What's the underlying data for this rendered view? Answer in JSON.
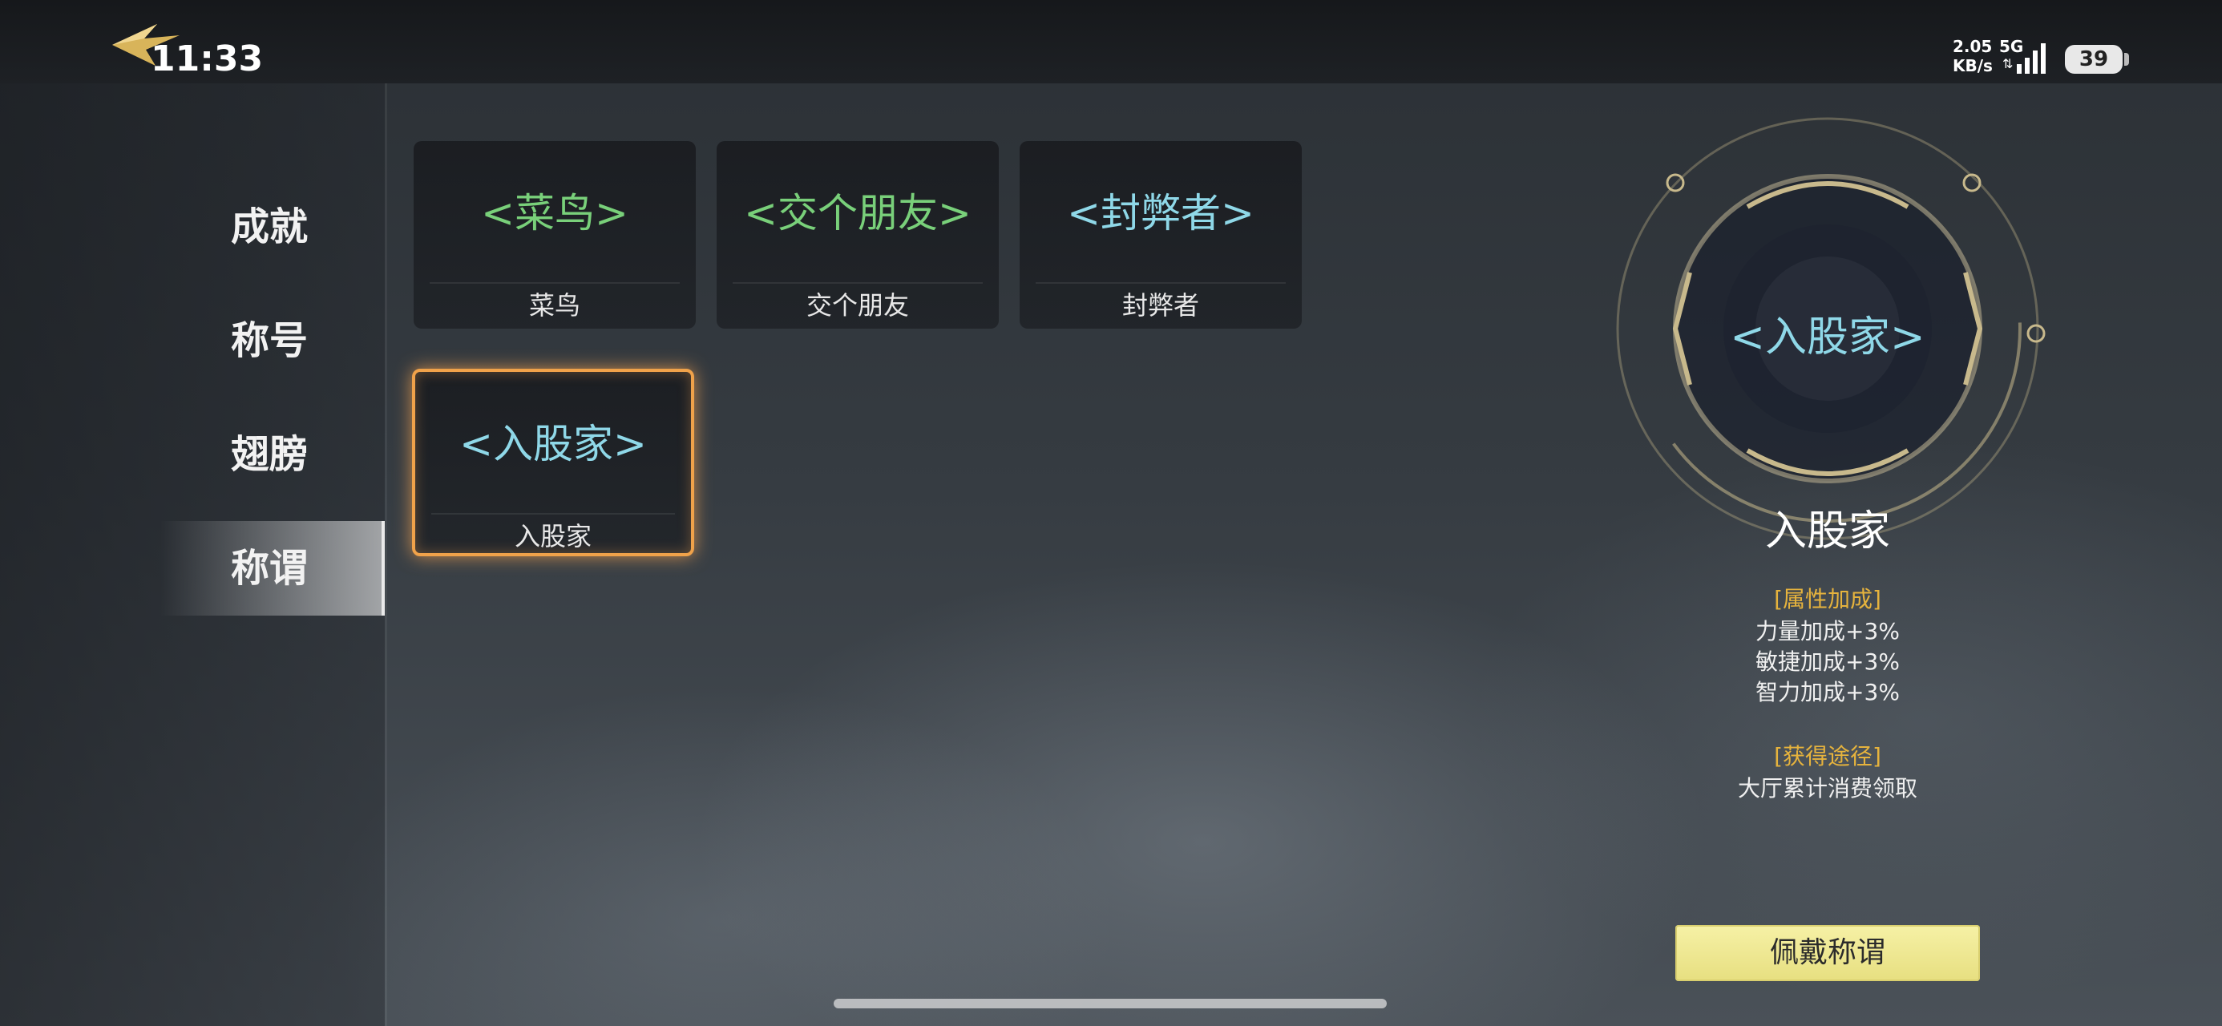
{
  "status_bar": {
    "time": "11:33",
    "net_speed_value": "2.05",
    "net_speed_unit": "KB/s",
    "network": "5G",
    "battery": "39"
  },
  "sidebar": {
    "items": [
      {
        "label": "成就"
      },
      {
        "label": "称号"
      },
      {
        "label": "翅膀"
      },
      {
        "label": "称谓",
        "active": true
      }
    ]
  },
  "cards": [
    {
      "title": "<菜鸟>",
      "name": "菜鸟",
      "title_color": "green"
    },
    {
      "title": "<交个朋友>",
      "name": "交个朋友",
      "title_color": "green"
    },
    {
      "title": "<封弊者>",
      "name": "封弊者",
      "title_color": "blue"
    },
    {
      "title": "<入股家>",
      "name": "入股家",
      "title_color": "blue",
      "selected": true
    }
  ],
  "detail": {
    "preview_title": "<入股家>",
    "name": "入股家",
    "attr_heading": "[属性加成]",
    "attrs": [
      "力量加成+3%",
      "敏捷加成+3%",
      "智力加成+3%"
    ],
    "source_heading": "[获得途径]",
    "source": "大厅累计消费领取",
    "wear_button": "佩戴称谓"
  },
  "colors": {
    "accent_orange": "#f0a24a",
    "title_green": "#79d07a",
    "title_blue": "#8fd8e8",
    "heading_gold": "#e6b33d",
    "button_yellow": "#f6f1a6"
  }
}
